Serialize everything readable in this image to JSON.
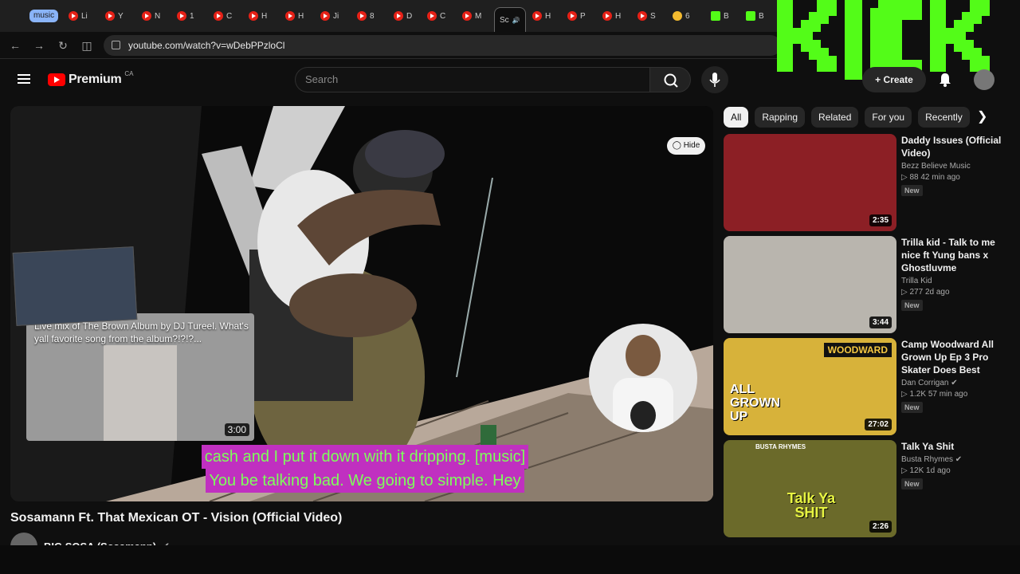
{
  "browser": {
    "tab_group_label": "music",
    "tabs": [
      {
        "label": "Li",
        "icon": "youtube-icon"
      },
      {
        "label": "Y",
        "icon": "youtube-icon"
      },
      {
        "label": "N",
        "icon": "youtube-icon"
      },
      {
        "label": "1",
        "icon": "youtube-icon"
      },
      {
        "label": "C",
        "icon": "youtube-icon"
      },
      {
        "label": "H",
        "icon": "youtube-icon"
      },
      {
        "label": "H",
        "icon": "youtube-icon"
      },
      {
        "label": "Ji",
        "icon": "youtube-icon"
      },
      {
        "label": "8",
        "icon": "youtube-icon"
      },
      {
        "label": "D",
        "icon": "youtube-icon"
      },
      {
        "label": "C",
        "icon": "youtube-icon"
      },
      {
        "label": "M",
        "icon": "youtube-icon"
      },
      {
        "label": "Sc",
        "icon": "speaker-icon",
        "active": true
      },
      {
        "label": "H",
        "icon": "youtube-icon"
      },
      {
        "label": "P",
        "icon": "youtube-icon"
      },
      {
        "label": "H",
        "icon": "youtube-icon"
      },
      {
        "label": "S",
        "icon": "youtube-icon"
      },
      {
        "label": "6",
        "icon": "binance-icon"
      },
      {
        "label": "B",
        "icon": "kick-icon"
      },
      {
        "label": "B",
        "icon": "kick-icon"
      }
    ],
    "url": "youtube.com/watch?v=wDebPPzloCl"
  },
  "overlay_brand": "KICK",
  "header": {
    "logo_text": "Premium",
    "country": "CA",
    "search_placeholder": "Search",
    "create_label": "Create"
  },
  "player": {
    "hide_label": "Hide",
    "subtitle_line1": "cash and I put it down with it dripping. [music]",
    "subtitle_line2": "You be talking bad. We going to simple. Hey",
    "overlay_title": "Live mix of The Brown Album by DJ Tureel. What's yall favorite song from the album?!?!?...",
    "overlay_duration": "3:00"
  },
  "video": {
    "title": "Sosamann Ft. That Mexican OT - Vision (Official Video)",
    "channel": "BIG SOSA (Sosamann)"
  },
  "chips": [
    "All",
    "Rapping",
    "Related",
    "For you",
    "Recently"
  ],
  "recommendations": [
    {
      "title": "Daddy Issues (Official Video)",
      "channel": "Bezz Believe Music",
      "views": "88",
      "age": "42 min ago",
      "badge": "New",
      "duration": "2:35",
      "verified": false
    },
    {
      "title": "Trilla kid - Talk to me nice ft Yung bans x Ghostluvme",
      "channel": "Trilla Kid",
      "views": "277",
      "age": "2d ago",
      "badge": "New",
      "duration": "3:44",
      "verified": false
    },
    {
      "title": "Camp Woodward All Grown Up Ep 3 Pro Skater Does Best Tric...",
      "channel": "Dan Corrigan",
      "views": "1.2K",
      "age": "57 min ago",
      "badge": "New",
      "duration": "27:02",
      "verified": true,
      "thumb_text_a": "WOODWARD",
      "thumb_text_b": "ALL GROWN UP"
    },
    {
      "title": "Talk Ya Shit",
      "channel": "Busta Rhymes",
      "views": "12K",
      "age": "1d ago",
      "badge": "New",
      "duration": "2:26",
      "verified": true,
      "thumb_text_a": "BUSTA RHYMES",
      "thumb_text_b": "Talk Ya SHIT"
    }
  ]
}
